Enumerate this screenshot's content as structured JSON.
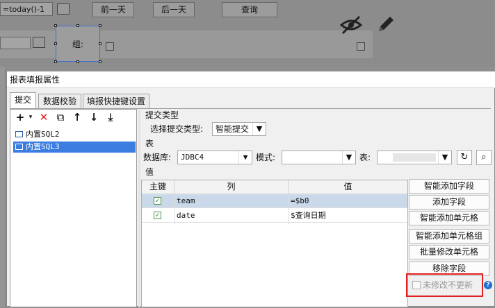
{
  "background": {
    "date_input": "=today()-1",
    "prev_day": "前一天",
    "next_day": "后一天",
    "query": "查询",
    "group_label": "组:"
  },
  "dialog": {
    "title": "报表填报属性",
    "tabs": [
      "提交",
      "数据校验",
      "填报快捷键设置"
    ],
    "toolbar": {
      "add": "+",
      "add_caret": "▾",
      "delete": "✕",
      "copy": "⧉",
      "up": "↑",
      "down": "↓",
      "bottom": "⤓"
    },
    "submit_list": [
      "内置SQL2",
      "内置SQL3"
    ],
    "submit_type_section": "提交类型",
    "submit_type_label": "选择提交类型:",
    "submit_type_value": "智能提交",
    "table_section": "表",
    "database_label": "数据库:",
    "database_value": "JDBC4",
    "schema_label": "模式:",
    "schema_value": "",
    "table_label": "表:",
    "table_value": "",
    "value_section": "值",
    "columns": [
      "主键",
      "列",
      "值"
    ],
    "rows": [
      {
        "key": true,
        "column": "team",
        "value": "=$b0"
      },
      {
        "key": true,
        "column": "date",
        "value": "$查询日期"
      }
    ],
    "buttons": [
      "智能添加字段",
      "添加字段",
      "智能添加单元格",
      "智能添加单元格组",
      "批量修改单元格",
      "移除字段"
    ],
    "unmodified_label": "未修改不更新",
    "help": "?"
  }
}
